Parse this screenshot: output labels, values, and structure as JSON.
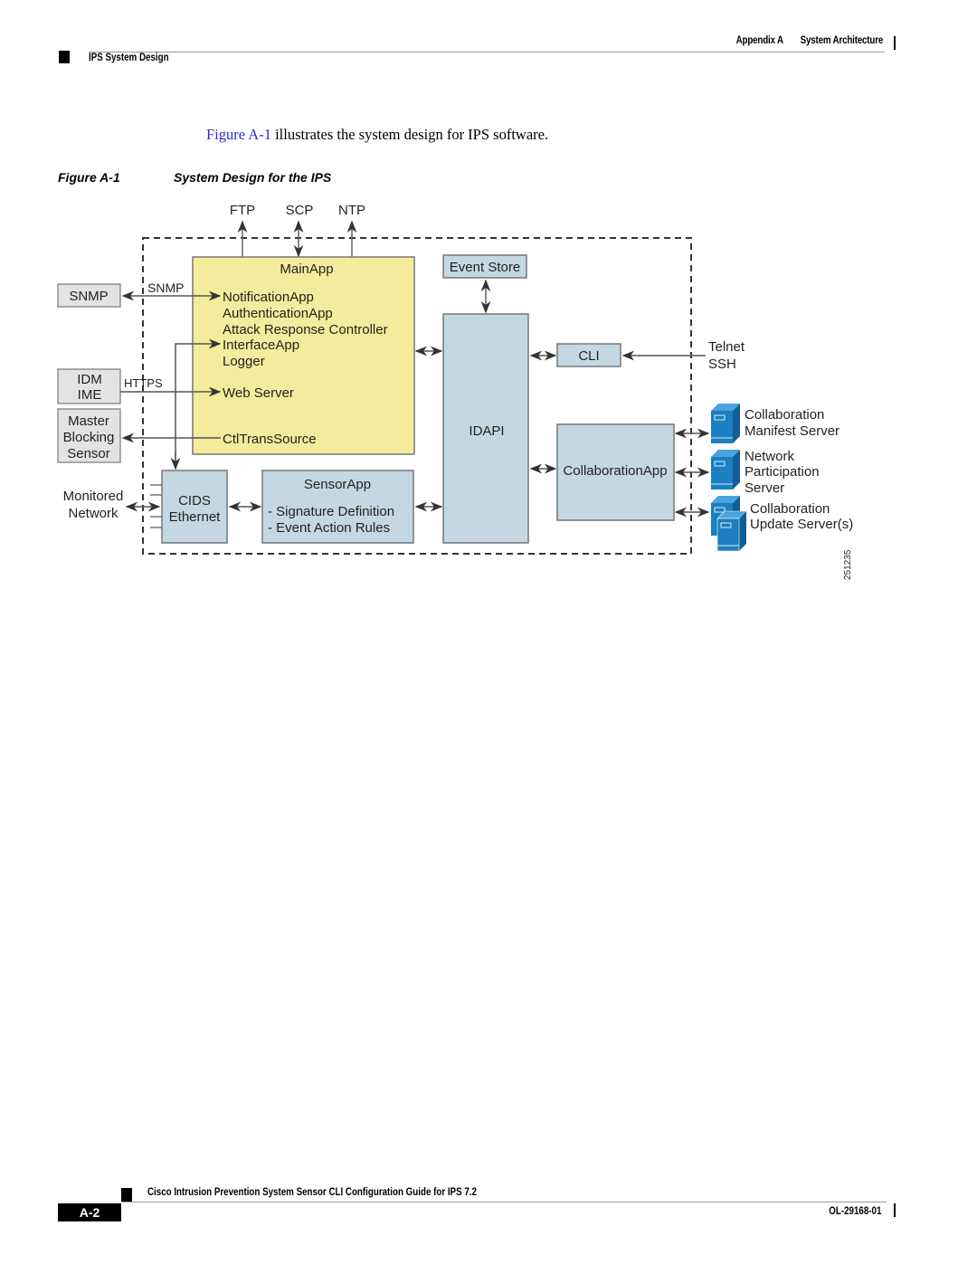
{
  "header": {
    "appendix": "Appendix A",
    "chapter": "System Architecture",
    "section": "IPS System Design"
  },
  "body": {
    "intro_link": "Figure A-1",
    "intro_text": " illustrates the system design for IPS software."
  },
  "figure": {
    "number": "Figure A-1",
    "title": "System Design for the IPS",
    "id_code": "251235",
    "top_protocols": [
      "FTP",
      "SCP",
      "NTP"
    ],
    "external_left": {
      "snmp_box": "SNMP",
      "snmp_link_label": "SNMP",
      "idm_box": [
        "IDM",
        "IME"
      ],
      "https_label": "HTTPS",
      "master_box": [
        "Master",
        "Blocking",
        "Sensor"
      ],
      "monitored": [
        "Monitored",
        "Network"
      ]
    },
    "mainapp": {
      "title": "MainApp",
      "items": [
        "NotificationApp",
        "AuthenticationApp",
        "Attack Response Controller",
        "InterfaceApp",
        "Logger",
        "Web Server",
        "CtlTransSource"
      ]
    },
    "event_store": "Event Store",
    "idapi": "IDAPI",
    "cli": "CLI",
    "cids": [
      "CIDS",
      "Ethernet"
    ],
    "sensorapp": {
      "title": "SensorApp",
      "items": [
        "- Signature Definition",
        "- Event Action Rules"
      ]
    },
    "collaboration_app": "CollaborationApp",
    "remote_access": [
      "Telnet",
      "SSH"
    ],
    "servers": [
      {
        "label": [
          "Collaboration",
          "Manifest Server"
        ],
        "icon": "server-icon"
      },
      {
        "label": [
          "Network",
          "Participation",
          "Server"
        ],
        "icon": "server-icon"
      },
      {
        "label": [
          "Collaboration",
          "Update Server(s)"
        ],
        "icon": "server-stack-icon"
      }
    ],
    "colors": {
      "mainapp_fill": "#f5eb9c",
      "component_fill": "#c3d8e2",
      "external_fill": "#e2e3e5",
      "server_blue": "#1b7fc0",
      "link": "#2b2bd6"
    }
  },
  "footer": {
    "guide_title": "Cisco Intrusion Prevention System Sensor CLI Configuration Guide for IPS 7.2",
    "page": "A-2",
    "doc_number": "OL-29168-01"
  }
}
